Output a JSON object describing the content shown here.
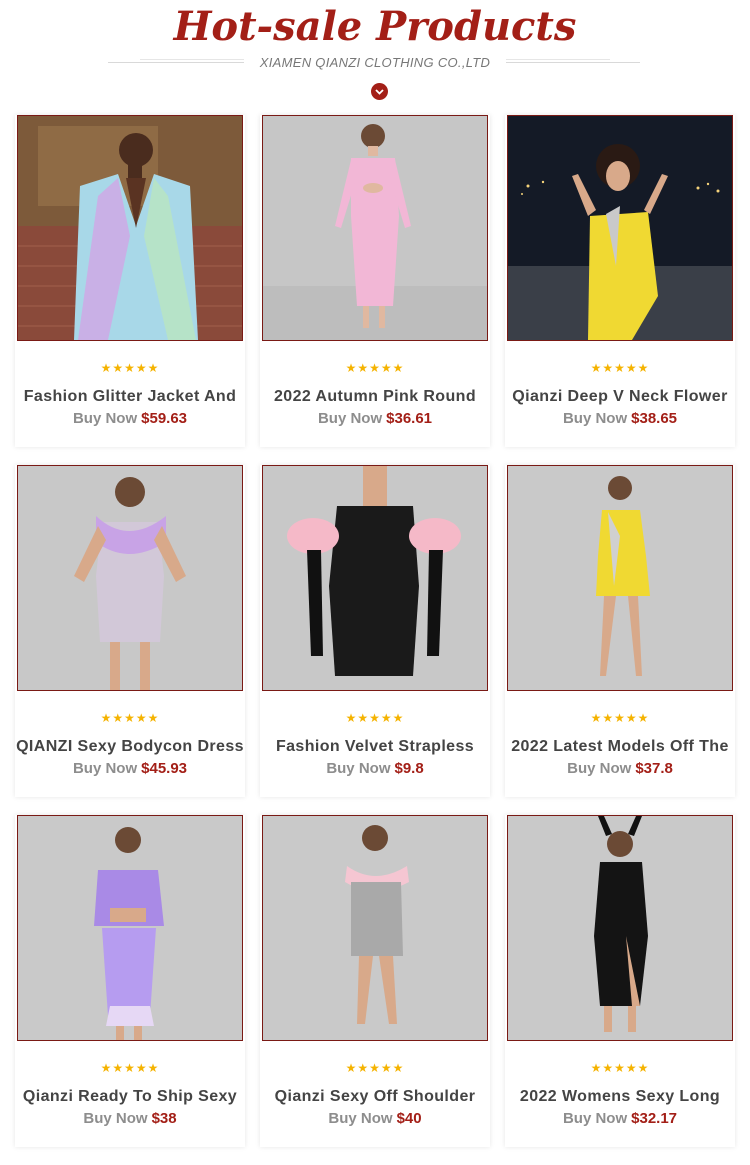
{
  "header": {
    "title": "Hot-sale Products",
    "subtitle": "XIAMEN QIANZI CLOTHING CO.,LTD",
    "toggle_icon": "chevron-down-icon"
  },
  "colors": {
    "accent": "#a31f17",
    "star": "#f5b301",
    "muted_text": "#8d8d8d"
  },
  "products": [
    {
      "name": "Fashion Glitter Jacket And",
      "buy_label": "Buy Now",
      "price": "$59.63",
      "rating": 5,
      "image": "woman-in-iridescent-blazer"
    },
    {
      "name": "2022 Autumn Pink Round",
      "buy_label": "Buy Now",
      "price": "$36.61",
      "rating": 5,
      "image": "woman-in-pink-cutout-dress"
    },
    {
      "name": "Qianzi Deep V Neck Flower",
      "buy_label": "Buy Now",
      "price": "$38.65",
      "rating": 5,
      "image": "woman-in-yellow-dress-night"
    },
    {
      "name": "QIANZI Sexy Bodycon Dress",
      "buy_label": "Buy Now",
      "price": "$45.93",
      "rating": 5,
      "image": "woman-in-sequin-feather-dress"
    },
    {
      "name": "Fashion Velvet Strapless",
      "buy_label": "Buy Now",
      "price": "$9.8",
      "rating": 5,
      "image": "woman-in-black-velvet-dress"
    },
    {
      "name": "2022 Latest Models Off The",
      "buy_label": "Buy Now",
      "price": "$37.8",
      "rating": 5,
      "image": "woman-in-yellow-mini-dress"
    },
    {
      "name": "Qianzi Ready To Ship Sexy",
      "buy_label": "Buy Now",
      "price": "$38",
      "rating": 5,
      "image": "woman-in-purple-two-piece"
    },
    {
      "name": "Qianzi Sexy Off Shoulder",
      "buy_label": "Buy Now",
      "price": "$40",
      "rating": 5,
      "image": "woman-in-silver-sequin-dress"
    },
    {
      "name": "2022 Womens Sexy Long",
      "buy_label": "Buy Now",
      "price": "$32.17",
      "rating": 5,
      "image": "woman-in-black-long-dress"
    }
  ]
}
